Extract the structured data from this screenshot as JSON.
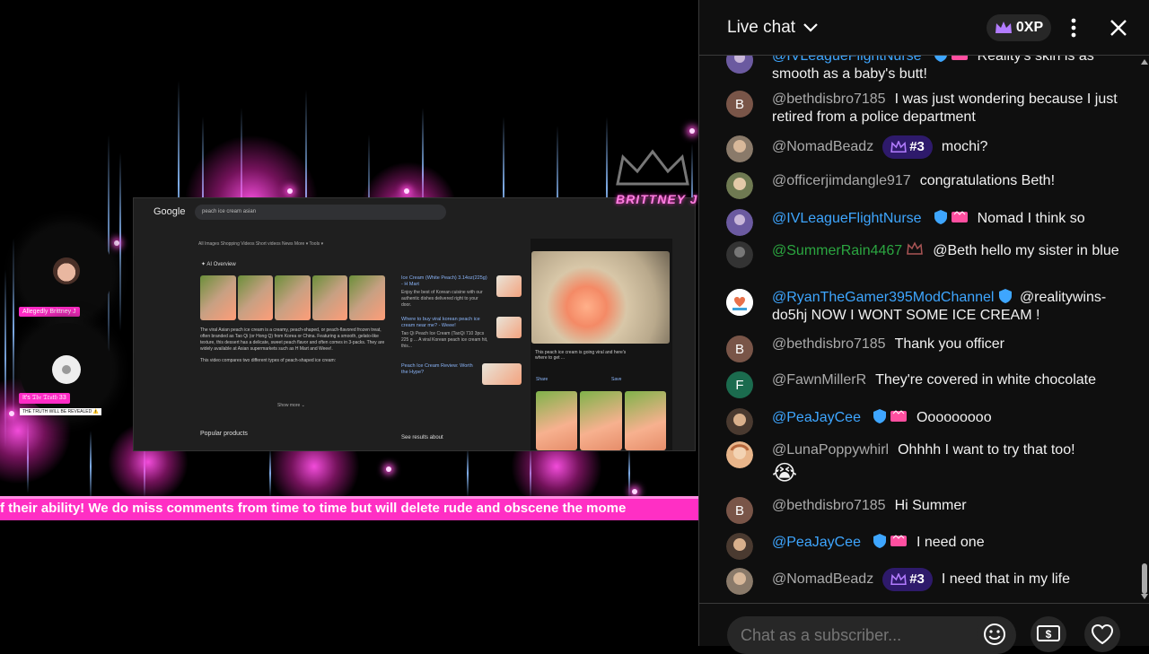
{
  "stream": {
    "brand_text": "BRITTNEY J",
    "cam1_label": "Allegedly Brittney J",
    "cam2_label": "It's 𝔗𝔥𝔢 𝔗𝔯𝔲𝔱𝔥 33",
    "cam2_sublabel": "THE TRUTH WILL BE REVEALED ⚠️",
    "ticker_text": "f their ability! We do miss comments from time to time but will delete rude and obscene the mome",
    "screen": {
      "logo": "Google",
      "query": "peach ice cream asian",
      "tabs": "All   Images   Shopping   Videos   Short videos   News   More ▾   Tools ▾",
      "ai_overview": "✦ AI Overview",
      "ai_text": "The viral Asian peach ice cream is a creamy, peach-shaped, or peach-flavored frozen treat, often branded as Tao Qi (or Hong Q) from Korea or China. Featuring a smooth, gelato-like texture, this dessert has a delicate, sweet peach flavor and often comes in 3-packs. They are widely available at Asian supermarkets such as H Mart and Weee!.",
      "ai_text2": "This video compares two different types of peach-shaped ice cream:",
      "mid_items": [
        {
          "title": "Ice Cream (White Peach) 3.14oz(225g) - H Mart",
          "text": "Enjoy the best of Korean cuisine with our authentic dishes delivered right to your door."
        },
        {
          "title": "Where to buy viral korean peach ice cream near me? - Weee!",
          "text": "Tao Qi Peach Ice Cream (TaoQi 710 3pcs 225 g ... A viral Korean peach ice cream hit, this..."
        },
        {
          "title": "Peach Ice Cream Review: Worth the Hype?",
          "text": ""
        }
      ],
      "show_more": "Show more ⌄",
      "popular": "Popular products",
      "see_results": "See results about",
      "right_caption": "This peach ice cream is going viral and here's where to get ...",
      "share": "Share",
      "save": "Save"
    }
  },
  "chat": {
    "title": "Live chat",
    "xp": "0XP",
    "input_placeholder": "Chat as a subscriber...",
    "messages": [
      {
        "author": "@IVLeagueFlightNurse",
        "text": "Reality's skin is as smooth as a baby's butt!"
      },
      {
        "author": "@bethdisbro7185",
        "avatar": "B",
        "text": "I was just wondering because I just retired from a police department"
      },
      {
        "author": "@NomadBeadz",
        "rank": "#3",
        "text": "mochi?"
      },
      {
        "author": "@officerjimdangle917",
        "text": "congratulations Beth!"
      },
      {
        "author": "@IVLeagueFlightNurse",
        "text": "Nomad I think so"
      },
      {
        "author": "@SummerRain4467",
        "text": "@Beth hello my sister in blue"
      },
      {
        "author": "@RyanTheGamer395ModChannel",
        "text": "@realitywins-do5hj NOW I WONT SOME ICE CREAM !"
      },
      {
        "author": "@bethdisbro7185",
        "avatar": "B",
        "text": "Thank you officer"
      },
      {
        "author": "@FawnMillerR",
        "avatar": "F",
        "text": "They're covered in white chocolate"
      },
      {
        "author": "@PeaJayCee",
        "text": "Ooooooooo"
      },
      {
        "author": "@LunaPoppywhirl",
        "text": "Ohhhh I want to try that too!",
        "emoji": "😭"
      },
      {
        "author": "@bethdisbro7185",
        "avatar": "B",
        "text": "Hi Summer"
      },
      {
        "author": "@PeaJayCee",
        "text": "I need one"
      },
      {
        "author": "@NomadBeadz",
        "rank": "#3",
        "text": "I need that in my life"
      }
    ]
  },
  "colors": {
    "accent": "#ff2fc4",
    "member_name": "#3ea6ff",
    "green_name": "#2ba640",
    "rank_bg": "#2e1a6b"
  }
}
